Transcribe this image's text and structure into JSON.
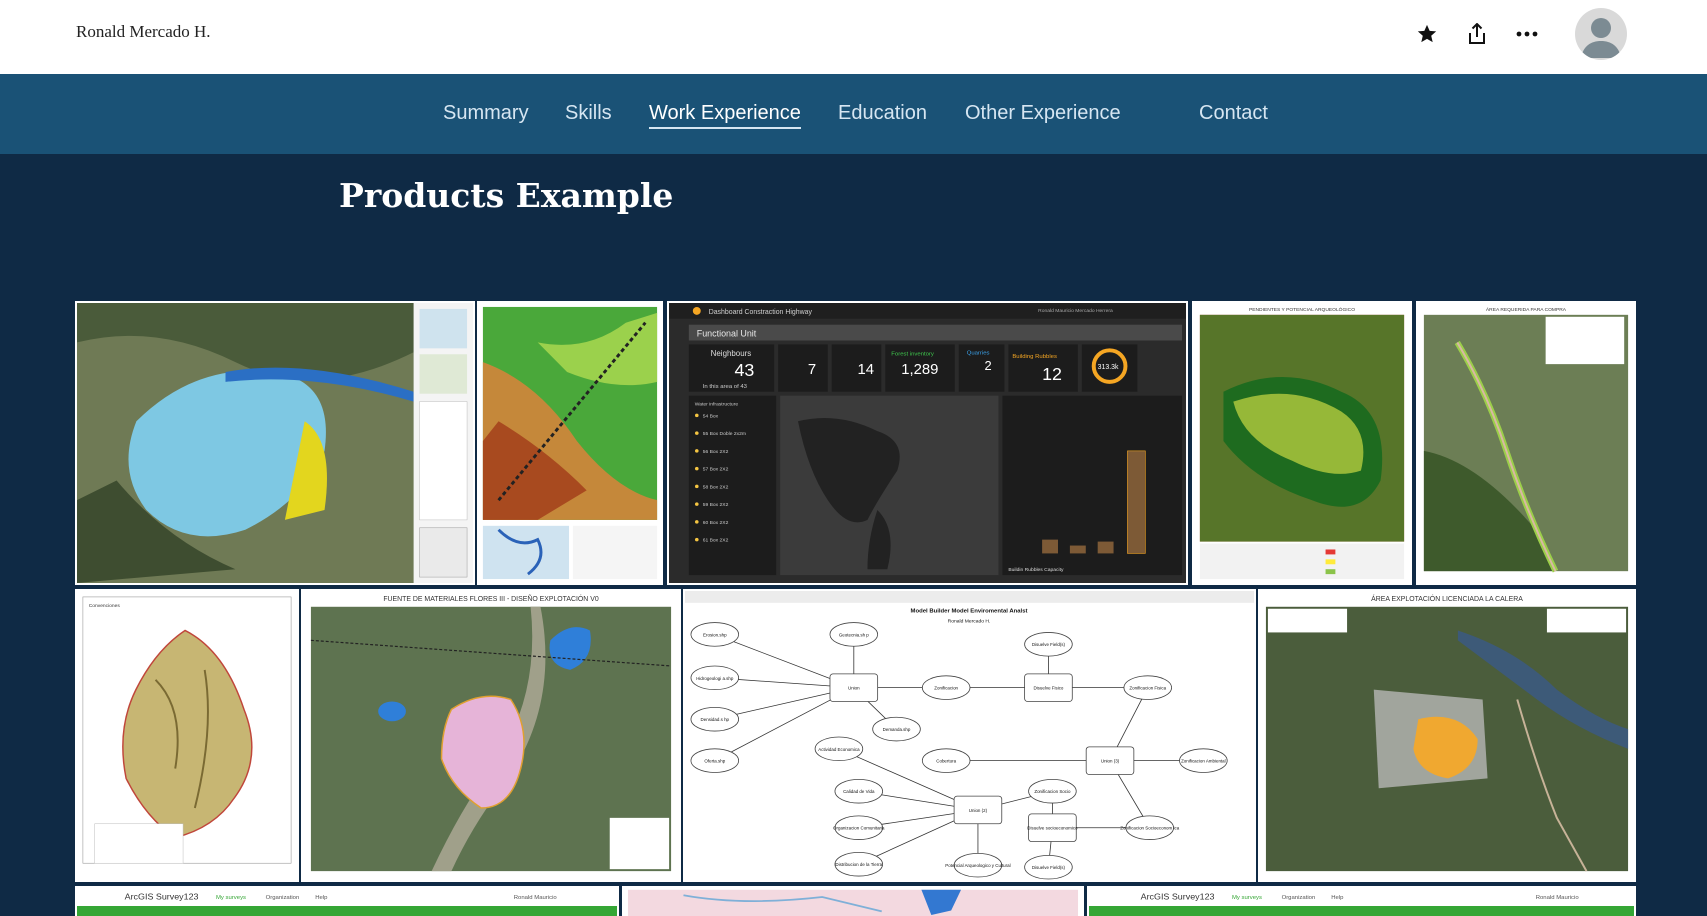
{
  "header": {
    "site_title": "Ronald Mercado H."
  },
  "nav": {
    "items": [
      {
        "label": "Summary"
      },
      {
        "label": "Skills"
      },
      {
        "label": "Work Experience",
        "active": true
      },
      {
        "label": "Education"
      },
      {
        "label": "Other Experience"
      },
      {
        "label": "Contact"
      }
    ]
  },
  "section": {
    "heading": "Products Example"
  },
  "gallery": {
    "dashboard": {
      "app_title": "Dashboard Constraction Highway",
      "user": "Ronald Mauricio Mercado Herrera",
      "panel_title": "Functional Unit",
      "neighbours_label": "Neighbours",
      "neighbours_value": "43",
      "neighbours_sub": "In this area of 43",
      "stat_a": "7",
      "stat_b": "14",
      "forest_label": "Forest inventory",
      "forest_value": "1,289",
      "quarries_label": "Quarries",
      "quarries_value": "2",
      "rubbles_label": "Building Rubbles",
      "rubbles_value": "12",
      "gauge_value": "313.3k",
      "list_title": "Water infrastructure",
      "list_items": [
        "54 Box",
        "55 Box Doble 2x2m",
        "56 Box 2X2",
        "57 Box 2X2",
        "58 Box 2X2",
        "59 Box 2X2",
        "60 Box 2X2",
        "61 Box 2X2"
      ],
      "chart_tab": "Buildin Rubbles Capacity"
    },
    "archaeo_title": "PENDIENTES Y POTENCIAL ARQUEOLÓGICO",
    "purchase_title": "ÁREA REQUERIDA PARA COMPRA",
    "watershed_legend": "Convenciones",
    "quarry_title": "FUENTE DE MATERIALES FLORES III - DISEÑO EXPLOTACIÓN V0",
    "model": {
      "title": "Model Builder Model Enviromental Analst",
      "author": "Ronald Mercado H.",
      "nodes": [
        "Erosion.shp",
        "Geotecnia.sh p",
        "Hidrogeologi a.shp",
        "Densidad.s hp",
        "Oferta.shp",
        "Union",
        "Zonificacion",
        "Disuelve Fisico",
        "Zonificacion Fisica",
        "Demanda.shp",
        "Actividad Economica",
        "Cobertura",
        "Union (3)",
        "Zonificacion Ambiental",
        "Calidad de Vida",
        "Organizacion Comunitaria",
        "Distribucion de la Tierra",
        "Union (2)",
        "Zonificacion Socio",
        "Disuelve socioeconomico",
        "Zonificacion Socioeconom ica",
        "Potencial Arqueologico y Cultural",
        "Disuelve Field(s)",
        "Disuelve Field(s)"
      ]
    },
    "calera_title": "ÁREA EXPLOTACIÓN LICENCIADA LA CALERA",
    "survey_app": "ArcGIS Survey123",
    "survey_tabs": [
      "My surveys",
      "Organization",
      "Help"
    ],
    "survey_user": "Ronald Mauricio"
  },
  "colors": {
    "nav_bg": "#1a5276",
    "page_bg": "#0f2a45",
    "accent_green": "#35a635"
  }
}
